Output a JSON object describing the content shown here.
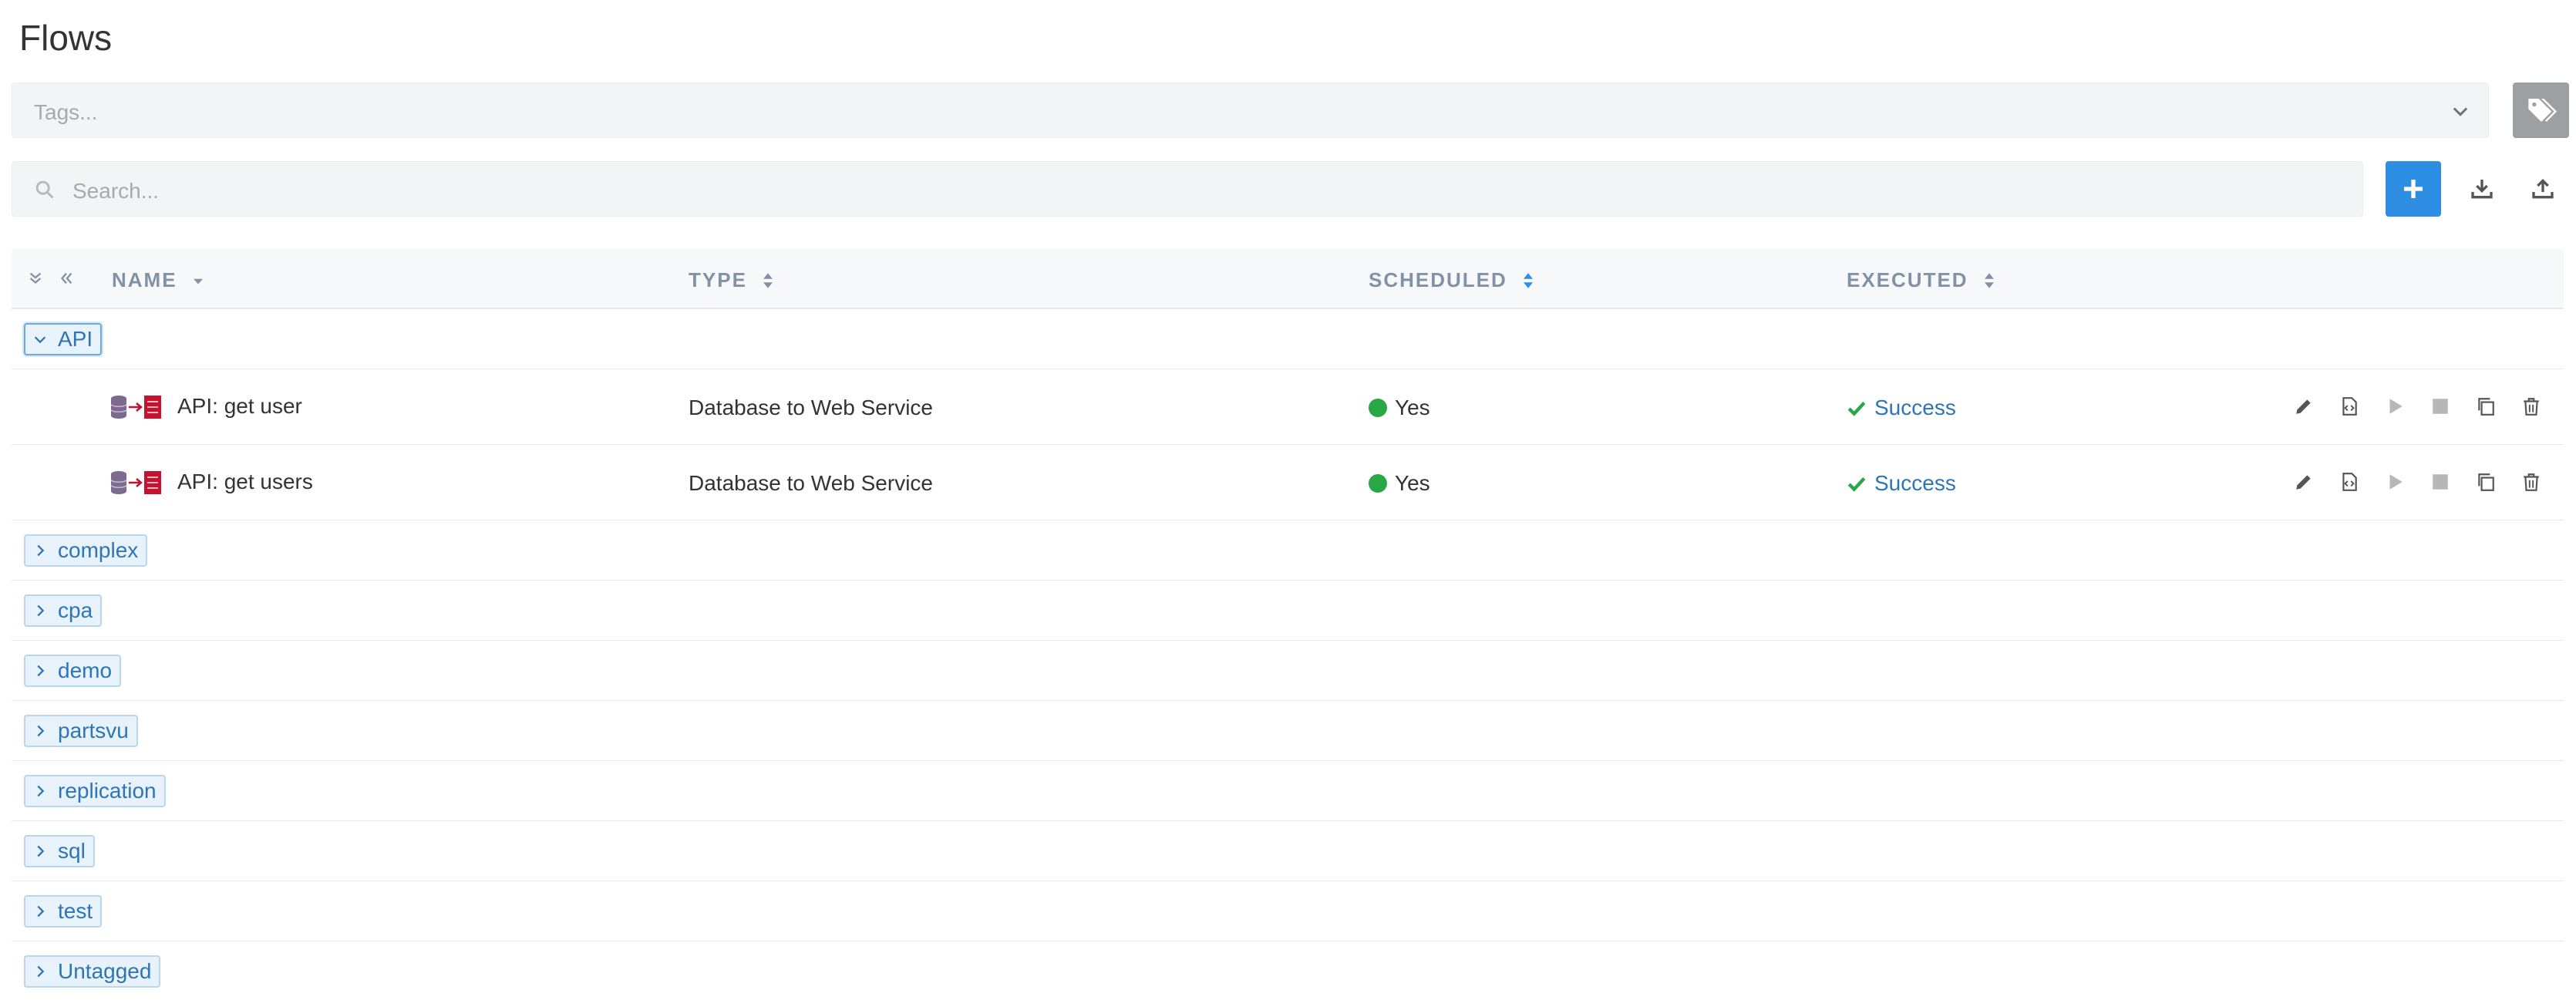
{
  "page": {
    "title": "Flows"
  },
  "tags": {
    "placeholder": "Tags..."
  },
  "search": {
    "placeholder": "Search..."
  },
  "table": {
    "columns": [
      {
        "key": "name",
        "label": "NAME"
      },
      {
        "key": "type",
        "label": "TYPE"
      },
      {
        "key": "scheduled",
        "label": "SCHEDULED"
      },
      {
        "key": "executed",
        "label": "EXECUTED"
      }
    ],
    "groups": [
      {
        "label": "API",
        "expanded": true
      },
      {
        "label": "complex",
        "expanded": false
      },
      {
        "label": "cpa",
        "expanded": false
      },
      {
        "label": "demo",
        "expanded": false
      },
      {
        "label": "partsvu",
        "expanded": false
      },
      {
        "label": "replication",
        "expanded": false
      },
      {
        "label": "sql",
        "expanded": false
      },
      {
        "label": "test",
        "expanded": false
      },
      {
        "label": "Untagged",
        "expanded": false
      }
    ],
    "api_flows": [
      {
        "name": "API: get user",
        "type": "Database to Web Service",
        "scheduled": "Yes",
        "executed": "Success"
      },
      {
        "name": "API: get users",
        "type": "Database to Web Service",
        "scheduled": "Yes",
        "executed": "Success"
      }
    ]
  },
  "icons": {
    "tags": "tags-icon",
    "search": "search-icon",
    "add": "plus-icon",
    "import": "download-icon",
    "export": "upload-icon",
    "edit": "pencil-icon",
    "code": "code-file-icon",
    "run": "play-icon",
    "stop": "stop-icon",
    "copy": "copy-icon",
    "delete": "trash-icon"
  },
  "colors": {
    "accent": "#2d8ee3",
    "success": "#28a745",
    "link": "#2d75b7"
  }
}
